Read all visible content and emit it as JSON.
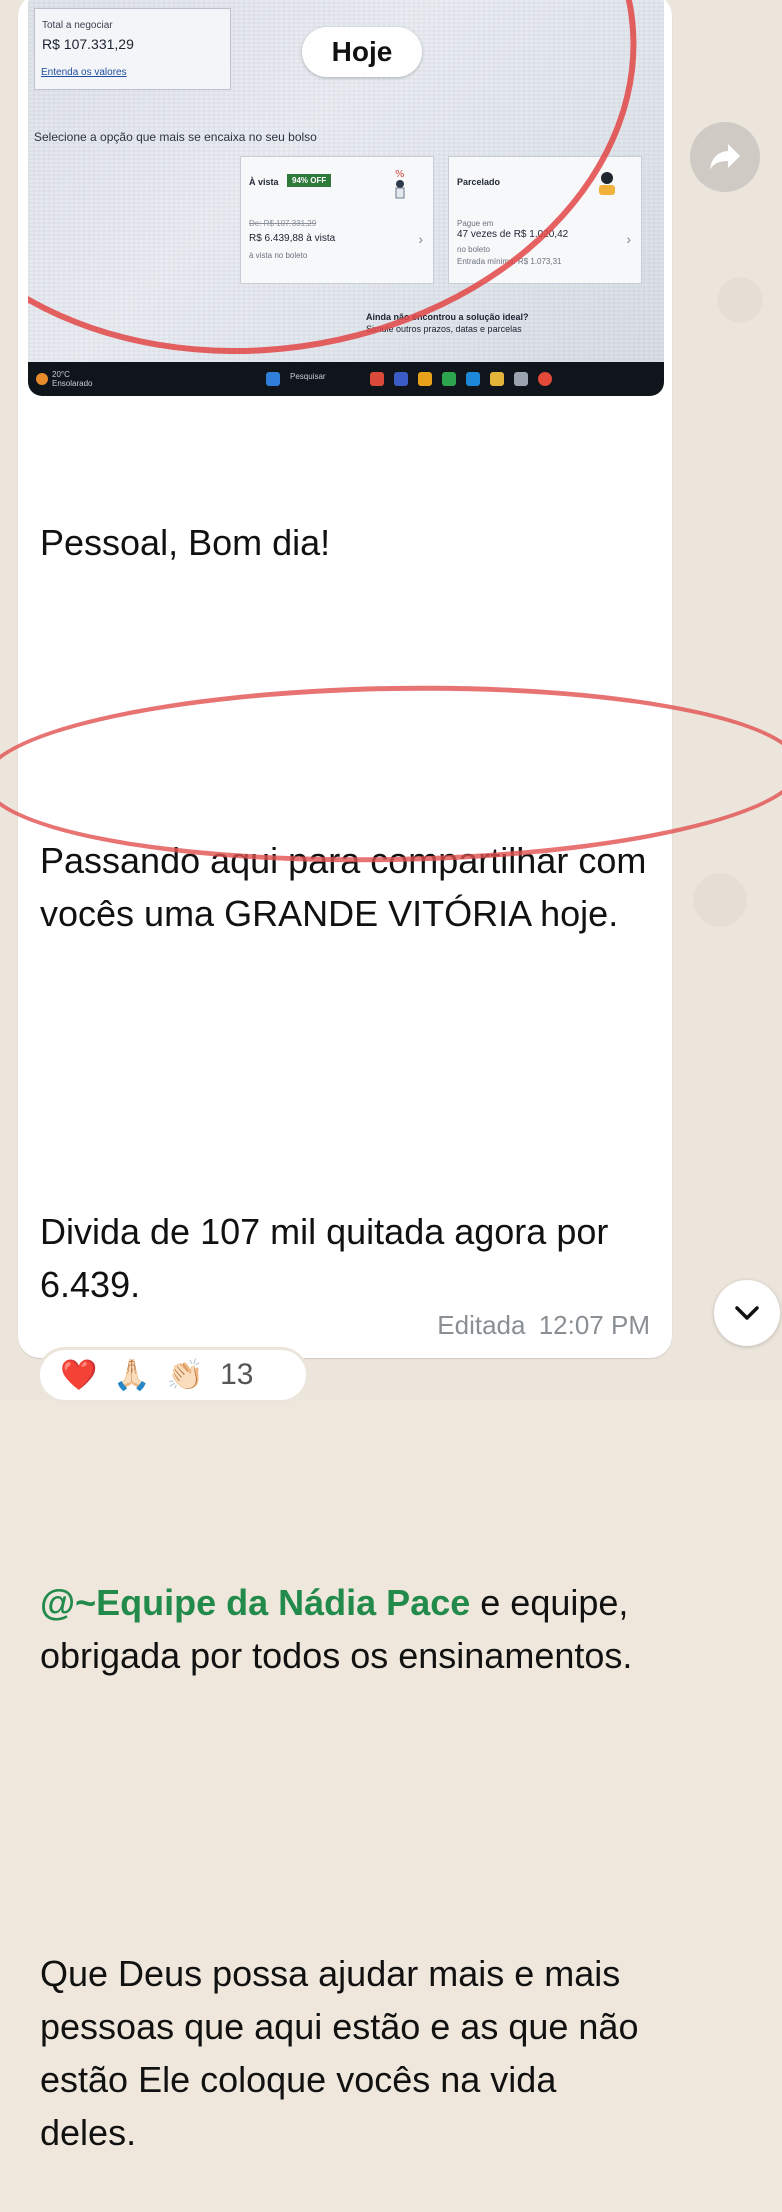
{
  "date_pill": "Hoje",
  "screenshot": {
    "total_label": "Total a negociar",
    "total_value": "R$ 107.331,29",
    "total_link": "Entenda os valores",
    "select_text": "Selecione a opção que mais se encaixa no seu bolso",
    "card_avista": {
      "title": "À vista",
      "badge": "94% OFF",
      "old_price": "De: R$ 107.331,29",
      "new_price": "R$ 6.439,88 à vista",
      "note": "à vista no boleto"
    },
    "card_parcelado": {
      "title": "Parcelado",
      "label": "Pague em",
      "installment": "47 vezes de R$ 1.020,42",
      "note": "no boleto",
      "entry": "Entrada mínima: R$ 1.073,31"
    },
    "help_text": "Ainda não encontrou a solução ideal?",
    "help_sub": "Simule outros prazos, datas e parcelas",
    "weather_temp": "20°C",
    "weather_desc": "Ensolarado",
    "search_placeholder": "Pesquisar"
  },
  "message": {
    "line1": "Pessoal, Bom dia!",
    "line2": "Passando aqui para compartilhar com vocês uma GRANDE VITÓRIA hoje.",
    "line3": "Divida de 107 mil quitada agora por 6.439.",
    "mention": "@~Equipe da Nádia Pace",
    "line4_rest": " e equipe, obrigada por todos os ensinamentos.",
    "line5": "Que Deus possa ajudar mais e mais pessoas que aqui estão e as que não estão Ele coloque vocês na vida deles."
  },
  "meta": {
    "edited": "Editada",
    "time": "12:07 PM"
  },
  "reactions": {
    "emojis": [
      "❤️",
      "🙏🏻",
      "👏🏻"
    ],
    "count": "13"
  },
  "icons": {
    "forward": "forward-icon",
    "scroll_down": "chevron-down-icon"
  },
  "colors": {
    "mention": "#228b4c",
    "annotation_red": "#e24646",
    "bubble": "#ffffff"
  }
}
